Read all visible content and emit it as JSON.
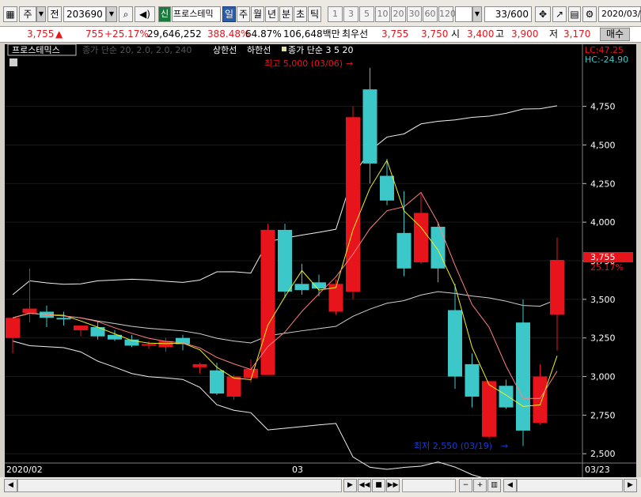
{
  "toolbar": {
    "market": "주",
    "prev": "전",
    "code": "203690",
    "badge": "신",
    "name": "프로스테믹",
    "periods": [
      "일",
      "주",
      "월",
      "년",
      "분",
      "초",
      "틱"
    ],
    "intervals": [
      "1",
      "3",
      "5",
      "10",
      "20",
      "30",
      "60",
      "120"
    ],
    "count": "33",
    "count_max": "/600",
    "date": "2020/03/"
  },
  "quote": {
    "price": "3,755",
    "arrow": "▲",
    "change": "755",
    "change_pct": "+25.17%",
    "volume": "29,646,252",
    "vol_ratio": "388.48%",
    "turnover": "64.87%",
    "amount": "106,648백만",
    "best_ask_label": "최우선",
    "best_ask": "3,755",
    "best_bid": "3,750",
    "open_label": "시",
    "open": "3,400",
    "high_label": "고",
    "high": "3,900",
    "low_label": "저",
    "low": "3,170",
    "buy_label": "매수"
  },
  "chart": {
    "legend_name": "프로스테믹스",
    "legend_bb": "종가 단순 20, 2.0, 2.0, 240",
    "legend_upper": "상한선",
    "legend_lower": "하한선",
    "legend_ma": "종가 단순 3  5  20",
    "lc_label": "LC:47.25",
    "hc_label": "HC:-24.90",
    "max_annotation": "최고 5,000 (03/06)",
    "min_annotation": "최저 2,550 (03/19)",
    "price_tag": "3,755",
    "pct_tag": "25.17%",
    "x_labels": [
      "2020/02",
      "03",
      "03/23"
    ],
    "y_ticks": [
      "4,750",
      "4,500",
      "4,250",
      "4,000",
      "3,750",
      "3,500",
      "3,250",
      "3,000",
      "2,750",
      "2,500"
    ]
  },
  "chart_data": {
    "type": "candlestick",
    "ylim": [
      2450,
      5050
    ],
    "up_color": "#e8141c",
    "down_color": "#3cc8c8",
    "candles": [
      {
        "o": 3250,
        "h": 3300,
        "l": 3150,
        "c": 3380
      },
      {
        "o": 3410,
        "h": 3700,
        "l": 3350,
        "c": 3440
      },
      {
        "o": 3420,
        "h": 3460,
        "l": 3320,
        "c": 3380
      },
      {
        "o": 3380,
        "h": 3420,
        "l": 3330,
        "c": 3370
      },
      {
        "o": 3300,
        "h": 3320,
        "l": 3260,
        "c": 3330
      },
      {
        "o": 3320,
        "h": 3360,
        "l": 3240,
        "c": 3260
      },
      {
        "o": 3270,
        "h": 3300,
        "l": 3230,
        "c": 3240
      },
      {
        "o": 3240,
        "h": 3270,
        "l": 3190,
        "c": 3200
      },
      {
        "o": 3200,
        "h": 3230,
        "l": 3180,
        "c": 3210
      },
      {
        "o": 3190,
        "h": 3250,
        "l": 3160,
        "c": 3230
      },
      {
        "o": 3250,
        "h": 3270,
        "l": 3170,
        "c": 3210
      },
      {
        "o": 3060,
        "h": 3090,
        "l": 3020,
        "c": 3080
      },
      {
        "o": 3040,
        "h": 3090,
        "l": 2880,
        "c": 2890
      },
      {
        "o": 2870,
        "h": 3010,
        "l": 2850,
        "c": 3000
      },
      {
        "o": 2990,
        "h": 3110,
        "l": 2960,
        "c": 3050
      },
      {
        "o": 3010,
        "h": 3990,
        "l": 3010,
        "c": 3950
      },
      {
        "o": 3950,
        "h": 3990,
        "l": 3510,
        "c": 3550
      },
      {
        "o": 3600,
        "h": 3730,
        "l": 3530,
        "c": 3560
      },
      {
        "o": 3610,
        "h": 3660,
        "l": 3520,
        "c": 3570
      },
      {
        "o": 3420,
        "h": 3630,
        "l": 3400,
        "c": 3600
      },
      {
        "o": 3550,
        "h": 4750,
        "l": 3500,
        "c": 4680
      },
      {
        "o": 4860,
        "h": 5000,
        "l": 4250,
        "c": 4380
      },
      {
        "o": 4300,
        "h": 4410,
        "l": 4110,
        "c": 4140
      },
      {
        "o": 3930,
        "h": 4200,
        "l": 3650,
        "c": 3700
      },
      {
        "o": 3740,
        "h": 4180,
        "l": 3730,
        "c": 4060
      },
      {
        "o": 3970,
        "h": 4000,
        "l": 3610,
        "c": 3700
      },
      {
        "o": 3430,
        "h": 3600,
        "l": 2920,
        "c": 3000
      },
      {
        "o": 3080,
        "h": 3150,
        "l": 2800,
        "c": 2870
      },
      {
        "o": 2610,
        "h": 2970,
        "l": 2600,
        "c": 2970
      },
      {
        "o": 2940,
        "h": 2980,
        "l": 2790,
        "c": 2800
      },
      {
        "o": 3350,
        "h": 3500,
        "l": 2550,
        "c": 2650
      },
      {
        "o": 2700,
        "h": 3080,
        "l": 2690,
        "c": 3000
      },
      {
        "o": 3400,
        "h": 3900,
        "l": 3170,
        "c": 3755
      }
    ]
  }
}
